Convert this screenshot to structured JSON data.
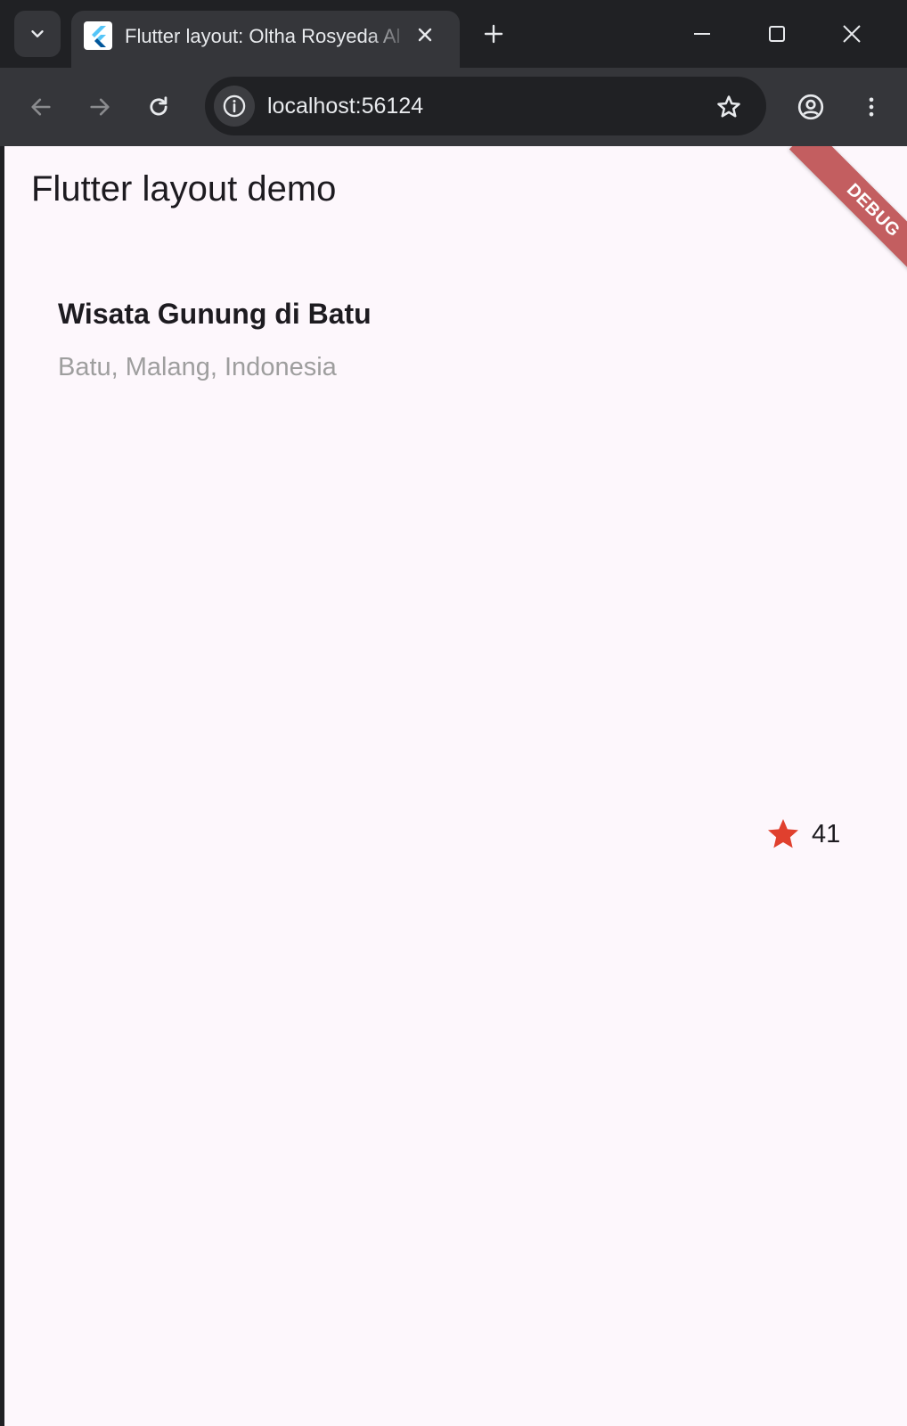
{
  "browser": {
    "tab": {
      "title": "Flutter layout: Oltha Rosyeda Al",
      "favicon": "flutter-logo-icon"
    },
    "address_bar": {
      "url": "localhost:56124"
    },
    "icons": {
      "tab_search": "chevron-down-icon",
      "close_tab": "close-icon",
      "new_tab": "plus-icon",
      "minimize": "minimize-icon",
      "maximize": "maximize-icon",
      "close_window": "close-icon",
      "back": "arrow-left-icon",
      "forward": "arrow-right-icon",
      "reload": "reload-icon",
      "site_info": "info-icon",
      "bookmark": "star-outline-icon",
      "profile": "account-circle-icon",
      "menu": "more-vert-icon"
    }
  },
  "app": {
    "appbar_title": "Flutter layout demo",
    "debug_banner": "DEBUG",
    "card": {
      "title": "Wisata Gunung di Batu",
      "subtitle": "Batu, Malang, Indonesia"
    },
    "rating": {
      "icon": "star-icon",
      "count": "41"
    }
  },
  "colors": {
    "chrome_dark": "#202124",
    "chrome_toolbar": "#35363a",
    "page_background": "#fdf7fc",
    "star_red": "#e0402e",
    "subtitle_grey": "#9e9e9e",
    "debug_banner": "#a00000"
  }
}
